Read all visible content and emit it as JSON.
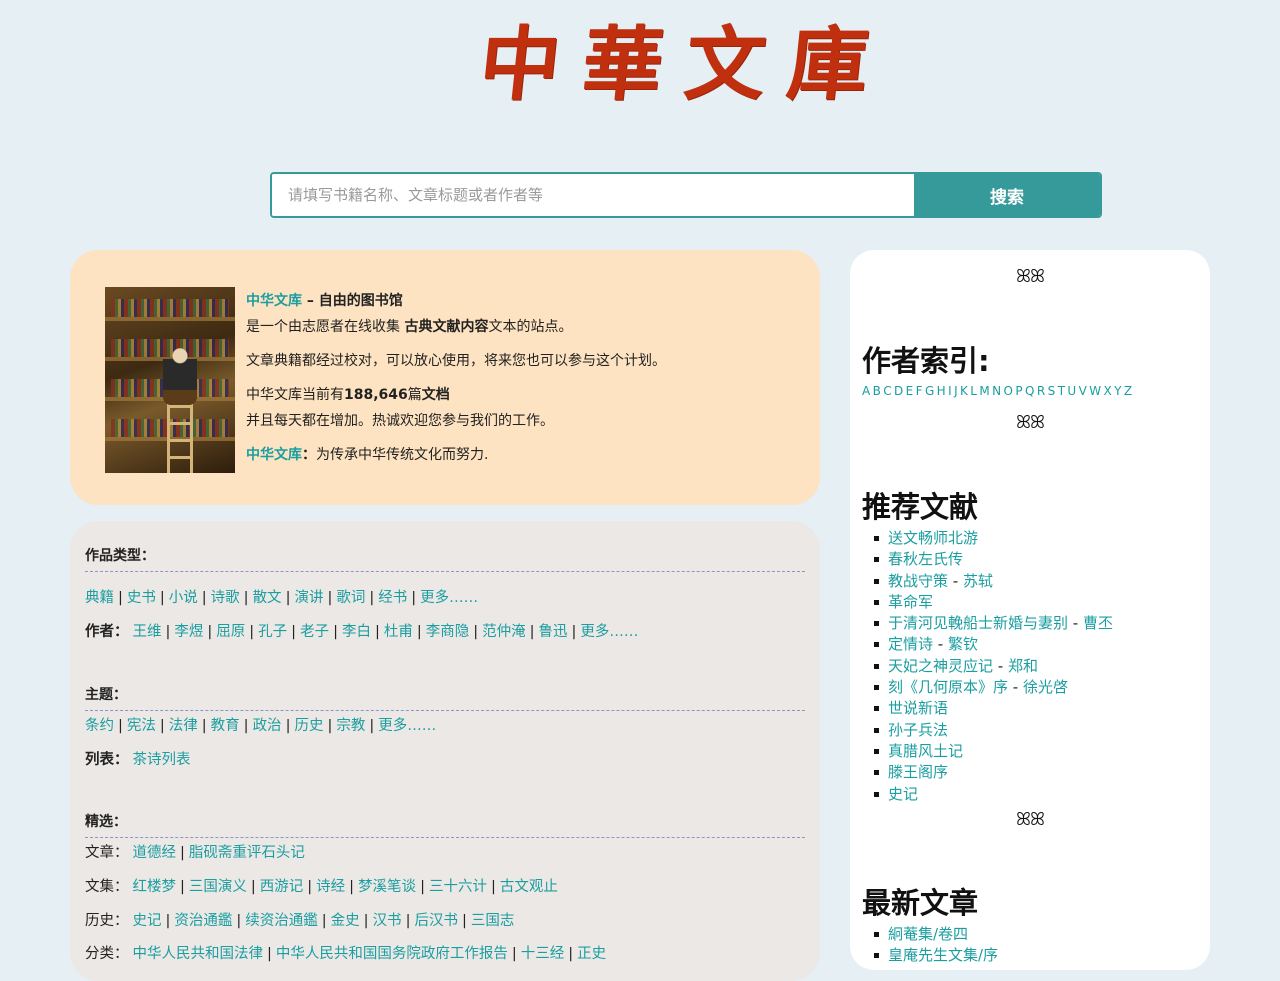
{
  "logo": {
    "chars": [
      "中",
      "華",
      "文",
      "庫"
    ]
  },
  "search": {
    "placeholder": "请填写书籍名称、文章标题或者作者等",
    "button": "搜索"
  },
  "intro": {
    "site_name": "中华文库",
    "dash": " – ",
    "tagline": "自由的图书馆",
    "line2_pre": "是一个由志愿者在线收集 ",
    "line2_bold": "古典文献内容",
    "line2_post": "文本的站点。",
    "line3": "文章典籍都经过校对，可以放心使用，将来您也可以参与这个计划。",
    "line4_pre": "中华文库当前有",
    "doc_count": "188,646",
    "line4_mid": "篇",
    "line4_bold": "文档",
    "line5": "并且每天都在增加。热诚欢迎您参与我们的工作。",
    "motto_link": "中华文库",
    "motto_colon": "：",
    "motto": "为传承中华传统文化而努力."
  },
  "categories": {
    "types_heading": "作品类型：",
    "types": [
      "典籍",
      "史书",
      "小说",
      "诗歌",
      "散文",
      "演讲",
      "歌词",
      "经书",
      "更多……"
    ],
    "authors_label": "作者：",
    "authors": [
      "王维",
      "李煜",
      "屈原",
      "孔子",
      "老子",
      "李白",
      "杜甫",
      "李商隐",
      "范仲淹",
      "鲁迅",
      "更多……"
    ],
    "topics_heading": "主题：",
    "topics": [
      "条约",
      "宪法",
      "法律",
      "教育",
      "政治",
      "历史",
      "宗教",
      "更多……"
    ],
    "lists_label": "列表：",
    "lists": [
      "茶诗列表"
    ],
    "featured_heading": "精选：",
    "articles_label": "文章：",
    "articles": [
      "道德经",
      "脂砚斋重评石头记"
    ],
    "collections_label": "文集：",
    "collections": [
      "红楼梦",
      "三国演义",
      "西游记",
      "诗经",
      "梦溪笔谈",
      "三十六计",
      "古文观止"
    ],
    "history_label": "历史：",
    "history": [
      "史记",
      "资治通鑑",
      "续资治通鑑",
      "金史",
      "汉书",
      "后汉书",
      "三国志"
    ],
    "class_label": "分类：",
    "classes": [
      "中华人民共和国法律",
      "中华人民共和国国务院政府工作报告",
      "十三经",
      "正史"
    ]
  },
  "sidebar": {
    "ornament": "ꕤ",
    "author_index_title": "作者索引:",
    "letters": [
      "A",
      "B",
      "C",
      "D",
      "E",
      "F",
      "G",
      "H",
      "I",
      "J",
      "K",
      "L",
      "M",
      "N",
      "O",
      "P",
      "Q",
      "R",
      "S",
      "T",
      "U",
      "V",
      "W",
      "X",
      "Y",
      "Z"
    ],
    "recommended_title": "推荐文献",
    "recommended": [
      {
        "title": "送文畅师北游",
        "author": ""
      },
      {
        "title": "春秋左氏传",
        "author": ""
      },
      {
        "title": "教战守策",
        "author": "苏轼"
      },
      {
        "title": "革命军",
        "author": ""
      },
      {
        "title": "于清河见輓船士新婚与妻别",
        "author": "曹丕"
      },
      {
        "title": "定情诗",
        "author": "繁钦"
      },
      {
        "title": "天妃之神灵应记",
        "author": "郑和"
      },
      {
        "title": "刻《几何原本》序",
        "author": "徐光啓"
      },
      {
        "title": "世说新语",
        "author": ""
      },
      {
        "title": "孙子兵法",
        "author": ""
      },
      {
        "title": "真腊风土记",
        "author": ""
      },
      {
        "title": "滕王阁序",
        "author": ""
      },
      {
        "title": "史记",
        "author": ""
      }
    ],
    "latest_title": "最新文章",
    "latest": [
      "絅菴集/卷四",
      "皇庵先生文集/序"
    ]
  }
}
